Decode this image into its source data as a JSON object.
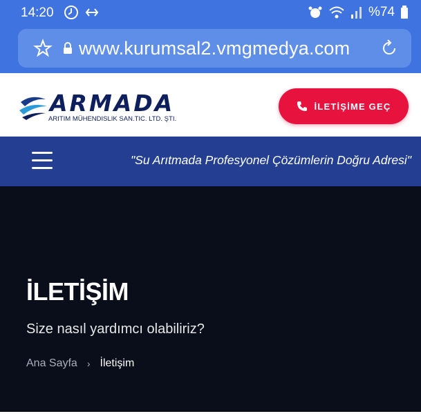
{
  "status_bar": {
    "time": "14:20",
    "battery": "%74",
    "icons": [
      "timer-icon",
      "alarm-icon",
      "wifi-icon",
      "signal-icon",
      "battery-icon"
    ]
  },
  "browser": {
    "url": "www.kurumsal2.vmgmedya.com",
    "icons": [
      "star-icon",
      "lock-icon",
      "reload-icon"
    ]
  },
  "header": {
    "logo_name": "ARMADA",
    "logo_subtitle": "ARITIM MÜHENDISLIK SAN.TIC. LTD. ŞTI.",
    "contact_button": "İLETİŞİME GEÇ"
  },
  "nav": {
    "slogan": "\"Su Arıtmada Profesyonel Çözümlerin Doğru Adresi\""
  },
  "hero": {
    "title": "İLETİŞİM",
    "subtitle": "Size nasıl yardımcı olabiliriz?",
    "breadcrumb": {
      "home": "Ana Sayfa",
      "separator": "›",
      "current": "İletişim"
    }
  },
  "colors": {
    "browser_bar": "#3f73e0",
    "nav_bar": "#243f91",
    "accent": "#e8123f",
    "hero_bg": "#0a0d1a",
    "logo": "#0d1f5c"
  }
}
